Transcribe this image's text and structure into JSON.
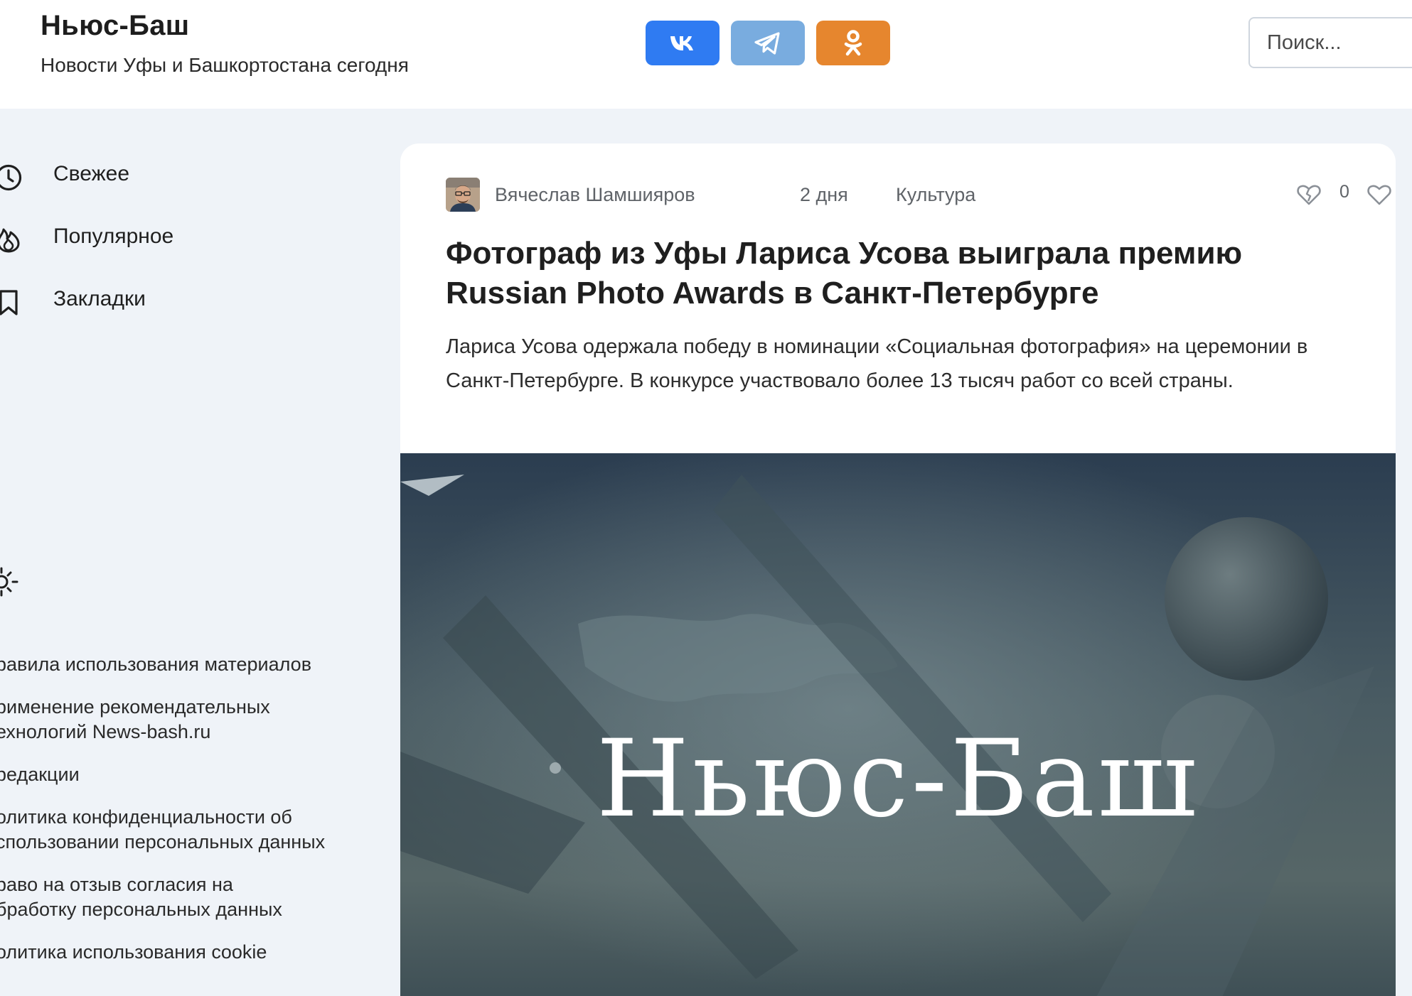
{
  "header": {
    "title": "Ньюс-Баш",
    "subtitle": "Новости Уфы и Башкортостана сегодня",
    "social": [
      {
        "name": "vk",
        "icon": "vk-icon",
        "color": "#2f7bf2"
      },
      {
        "name": "telegram",
        "icon": "telegram-icon",
        "color": "#79acdf"
      },
      {
        "name": "odnoklassniki",
        "icon": "odnoklassniki-icon",
        "color": "#e6862e"
      }
    ],
    "search_placeholder": "Поиск..."
  },
  "sidebar": {
    "nav": [
      {
        "label": "Свежее",
        "icon": "clock-icon"
      },
      {
        "label": "Популярное",
        "icon": "fire-icon"
      },
      {
        "label": "Закладки",
        "icon": "bookmark-icon"
      }
    ],
    "theme_icon": "sun-icon",
    "footer_links": [
      "равила использования материалов",
      "рименение рекомендательных\nехнологий News-bash.ru",
      " редакции",
      "олитика конфиденциальности об\nспользовании персональных данных",
      "раво на отзыв согласия на\nбработку персональных данных",
      "олитика использования cookie"
    ]
  },
  "article": {
    "author": "Вячеслав Шамшияров",
    "time": "2 дня",
    "category": "Культура",
    "rating": "0",
    "headline": "Фотограф из Уфы Лариса Усова выиграла премию Russian Photo Awards в Санкт-Петербурге",
    "lede": "Лариса Усова одержала победу в номинации «Социальная фотография» на церемонии в Санкт-Петербурге. В конкурсе участвовало более 13 тысяч работ со всей страны.",
    "image_text": "Ньюс-Баш"
  },
  "colors": {
    "page_bg": "#eff3f8",
    "vk": "#2f7bf2",
    "telegram": "#79acdf",
    "odnoklassniki": "#e6862e",
    "meta_text": "#5f6368"
  }
}
